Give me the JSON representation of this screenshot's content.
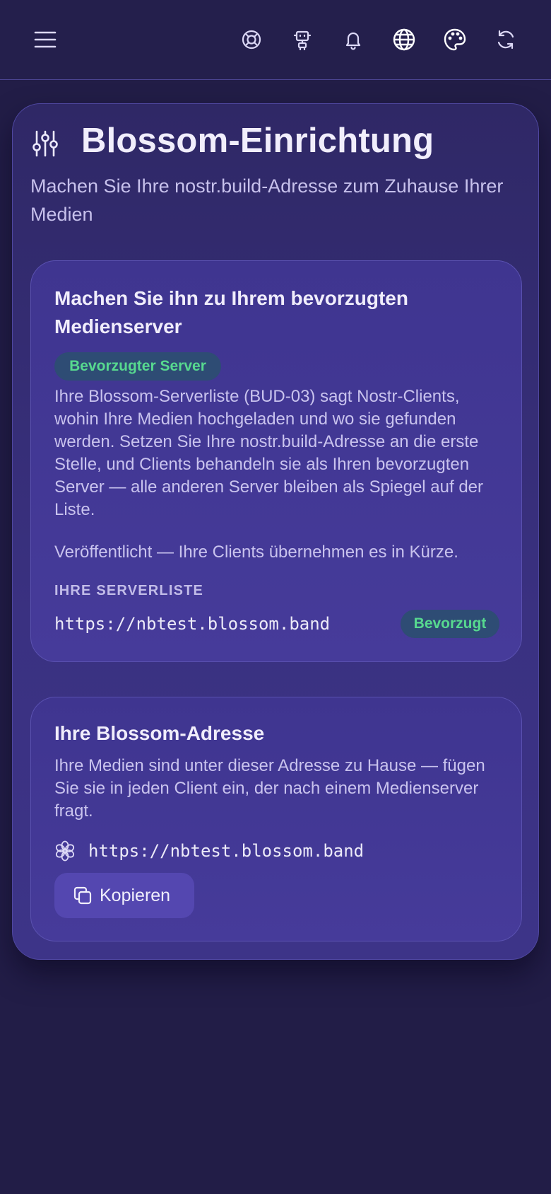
{
  "topbar": {
    "icons": [
      "menu-icon",
      "lifebuoy-icon",
      "robot-icon",
      "bell-icon",
      "globe-icon",
      "palette-icon",
      "refresh-icon"
    ]
  },
  "page": {
    "title": "Blossom-Einrichtung",
    "subtitle": "Machen Sie Ihre nostr.build-Adresse zum Zuhause Ihrer Medien",
    "title_icon": "sliders-icon"
  },
  "preferred_card": {
    "title": "Machen Sie ihn zu Ihrem bevorzugten Medienserver",
    "badge": "Bevorzugter Server",
    "description": "Ihre Blossom-Serverliste (BUD-03) sagt Nostr-Clients, wohin Ihre Medien hochgeladen und wo sie gefunden werden. Setzen Sie Ihre nostr.build-Adresse an die erste Stelle, und Clients behandeln sie als Ihren bevorzugten Server — alle anderen Server bleiben als Spiegel auf der Liste.",
    "status": "Veröffentlicht — Ihre Clients übernehmen es in Kürze.",
    "list_label": "IHRE SERVERLISTE",
    "servers": [
      {
        "url": "https://nbtest.blossom.band",
        "badge": "Bevorzugt"
      }
    ]
  },
  "address_card": {
    "title": "Ihre Blossom-Adresse",
    "description": "Ihre Medien sind unter dieser Adresse zu Hause — fügen Sie sie in jeden Client ein, der nach einem Medienserver fragt.",
    "address": "https://nbtest.blossom.band",
    "address_icon": "blossom-flower-icon",
    "copy_label": "Kopieren",
    "copy_icon": "copy-icon"
  },
  "colors": {
    "background": "#221d47",
    "card": "#433896",
    "badge_bg": "#2e4c74",
    "badge_text": "#57d98f",
    "button": "#5447b0"
  }
}
